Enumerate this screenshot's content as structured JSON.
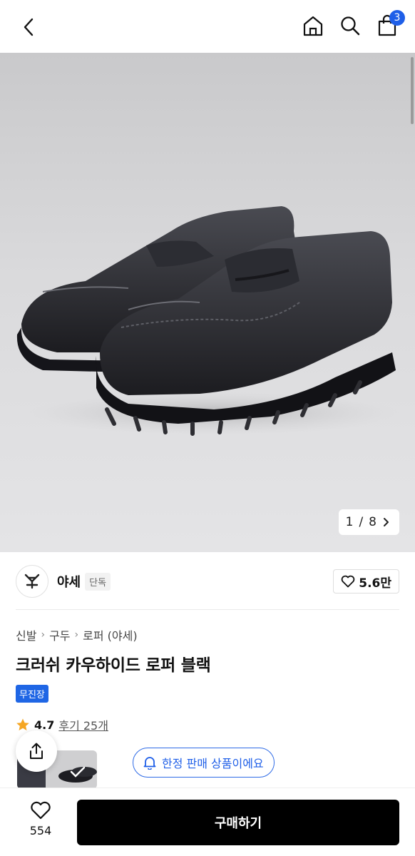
{
  "header": {
    "cart_count": "3"
  },
  "gallery": {
    "current": "1",
    "total": "8",
    "separator": "/"
  },
  "seller": {
    "name": "야세",
    "tag": "단독",
    "likes": "5.6만"
  },
  "breadcrumb": [
    "신발",
    "구두",
    "로퍼 (야세)"
  ],
  "product": {
    "title": "크러쉬 카우하이드 로퍼 블랙",
    "badge": "무진장",
    "rating": "4.7",
    "reviews": "후기 25개",
    "rating_value": 4.7
  },
  "notice": {
    "text": "한정 판매 상품이에요"
  },
  "bottom": {
    "wish_count": "554",
    "buy_label": "구매하기"
  },
  "colors": {
    "accent": "#1f5fe8",
    "star": "#f5a623",
    "buy_bg": "#000000"
  }
}
